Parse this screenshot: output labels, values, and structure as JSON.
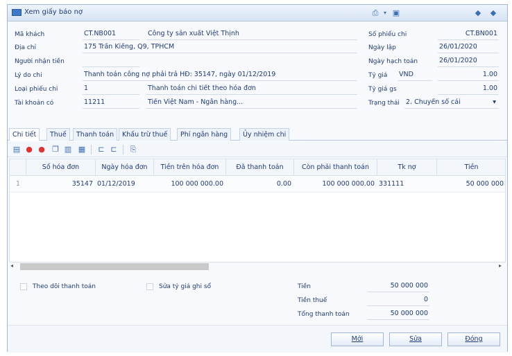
{
  "window": {
    "title": "Xem giấy báo nợ",
    "colors": {
      "accent": "#3b6fb6",
      "border": "#9fb6d6",
      "text": "#1f3a78"
    }
  },
  "header": {
    "ma_khach_label": "Mã khách",
    "ma_khach_value": "CT.NB001",
    "ten_khach_value": "Công ty sản xuất Việt Thịnh",
    "dia_chi_label": "Địa chỉ",
    "dia_chi_value": "175 Trần Kiếng, Q9, TPHCM",
    "nguoi_nhan_label": "Người nhận tiền",
    "nguoi_nhan_value": "",
    "ly_do_label": "Lý do chi",
    "ly_do_value": "Thanh toán công nợ phải trả HĐ: 35147, ngày 01/12/2019",
    "loai_phieu_label": "Loại phiếu chi",
    "loai_phieu_value": "1",
    "loai_phieu_desc": "Thanh toán chi tiết theo hóa đơn",
    "tai_khoan_label": "Tài khoản có",
    "tai_khoan_value": "11211",
    "tai_khoan_desc": "Tiền Việt Nam - Ngân hàng...",
    "so_phieu_label": "Số phiếu chi",
    "so_phieu_value": "CT.BN001",
    "ngay_lap_label": "Ngày lập",
    "ngay_lap_value": "26/01/2020",
    "ngay_hach_toan_label": "Ngày hạch toán",
    "ngay_hach_toan_value": "26/01/2020",
    "ty_gia_label": "Tỷ giá",
    "ty_gia_currency": "VND",
    "ty_gia_value": "1.00",
    "ty_gia_gs_label": "Tỷ giá gs",
    "ty_gia_gs_value": "1.00",
    "trang_thai_label": "Trạng thái",
    "trang_thai_value": "2. Chuyển sổ cái"
  },
  "tabs": [
    {
      "label": "Chi tiết"
    },
    {
      "label": "Thuế"
    },
    {
      "label": "Thanh toán"
    },
    {
      "label": "Khấu trừ thuế"
    },
    {
      "label": "Phí ngân hàng"
    },
    {
      "label": "Ủy nhiệm chi"
    }
  ],
  "grid": {
    "columns": [
      "Số hóa đơn",
      "Ngày hóa đơn",
      "Tiền trên hóa đơn",
      "Đã thanh toán",
      "Còn phải thanh toán",
      "Tk nợ",
      "Tiền"
    ],
    "rows": [
      {
        "index": "1",
        "so_hd": "35147",
        "ngay_hd": "01/12/2019",
        "tien_hd": "100 000 000.00",
        "da_tt": "0.00",
        "con_tt": "100 000 000.00",
        "tk_no": "331111",
        "tien": "50 000 000"
      }
    ]
  },
  "bottom": {
    "theo_doi_label": "Theo dõi thanh toán",
    "sua_ty_gia_label": "Sửa tỷ giá ghi sổ",
    "tien_label": "Tiền",
    "tien_value": "50 000 000",
    "tien_thue_label": "Tiền thuế",
    "tien_thue_value": "0",
    "tong_tt_label": "Tổng thanh toán",
    "tong_tt_value": "50 000 000"
  },
  "footer": {
    "moi_label": "Mới",
    "sua_label": "Sửa",
    "dong_label": "Đóng"
  }
}
